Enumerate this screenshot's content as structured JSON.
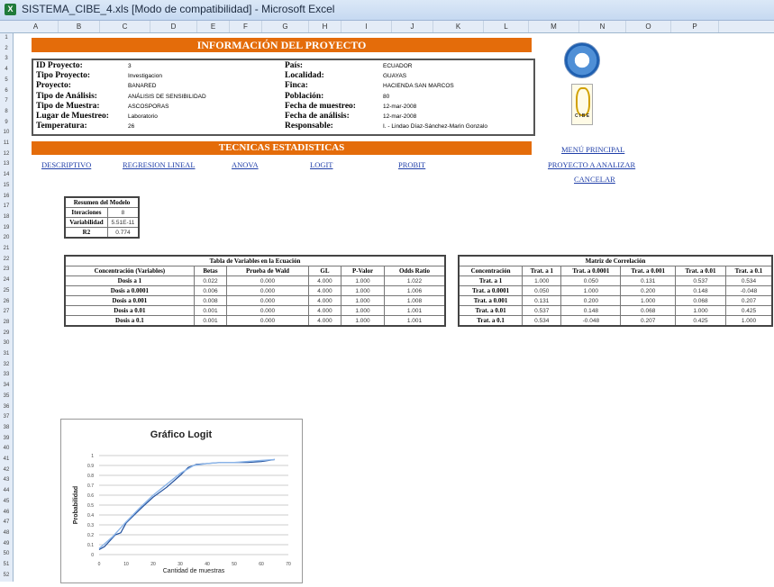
{
  "window": {
    "title": "SISTEMA_CIBE_4.xls  [Modo de compatibilidad] - Microsoft Excel",
    "app_icon": "excel-icon"
  },
  "columns": [
    "A",
    "B",
    "C",
    "D",
    "E",
    "F",
    "G",
    "H",
    "I",
    "J",
    "K",
    "L",
    "M",
    "N",
    "O",
    "P"
  ],
  "rows": [
    "1",
    "2",
    "3",
    "4",
    "5",
    "6",
    "7",
    "8",
    "9",
    "10",
    "11",
    "12",
    "13",
    "14",
    "15",
    "16",
    "17",
    "18",
    "19",
    "20",
    "21",
    "22",
    "23",
    "24",
    "25",
    "26",
    "27",
    "28",
    "29",
    "30",
    "31",
    "32",
    "33",
    "34",
    "35",
    "36",
    "37",
    "38",
    "39",
    "40",
    "41",
    "42",
    "43",
    "44",
    "45",
    "46",
    "47",
    "48",
    "49",
    "50",
    "51",
    "52"
  ],
  "header": {
    "title": "INFORMACIÓN DEL PROYECTO"
  },
  "info": {
    "left": [
      {
        "label": "ID Proyecto:",
        "value": "3"
      },
      {
        "label": "Tipo Proyecto:",
        "value": "Investigacion"
      },
      {
        "label": "Proyecto:",
        "value": "BANARED"
      },
      {
        "label": "Tipo de Análisis:",
        "value": "ANÁLISIS DE SENSIBILIDAD"
      },
      {
        "label": "Tipo de Muestra:",
        "value": "ASCOSPORAS"
      },
      {
        "label": "Lugar de Muestreo:",
        "value": "Laboratorio"
      },
      {
        "label": "Temperatura:",
        "value": "26"
      }
    ],
    "right": [
      {
        "label": "País:",
        "value": "ECUADOR"
      },
      {
        "label": "Localidad:",
        "value": "GUAYAS"
      },
      {
        "label": "Finca:",
        "value": "HACIENDA SAN MARCOS"
      },
      {
        "label": "Población:",
        "value": "80"
      },
      {
        "label": "Fecha de muestreo:",
        "value": "12-mar-2008"
      },
      {
        "label": "Fecha de análisis:",
        "value": "12-mar-2008"
      },
      {
        "label": "Responsable:",
        "value": "I. - Lindao Díaz-Sánchez-Marin Gonzalo"
      }
    ]
  },
  "logos": {
    "logo1": "university-seal",
    "logo2_text": "C I B E"
  },
  "techniques": {
    "title": "TECNICAS ESTADISTICAS",
    "links": [
      "DESCRIPTIVO",
      "REGRESION LINEAL",
      "ANOVA",
      "LOGIT",
      "PROBIT"
    ]
  },
  "menu": {
    "principal": "MENÚ PRINCIPAL",
    "proyecto": "PROYECTO A ANALIZAR",
    "cancelar": "CANCELAR"
  },
  "model_summary": {
    "title": "Resumen del Modelo",
    "rows": [
      {
        "label": "Iteraciones",
        "value": "8"
      },
      {
        "label": "Variabilidad",
        "value": "5.51E-11"
      },
      {
        "label": "R2",
        "value": "0.774"
      }
    ]
  },
  "variables_table": {
    "title": "Tabla de Variables en la Ecuación",
    "headers": [
      "Concentración (Variables)",
      "Betas",
      "Prueba de Wald",
      "GL",
      "P-Valor",
      "Odds Ratio"
    ],
    "rows": [
      [
        "Dosis a 1",
        "0.022",
        "0.000",
        "4.000",
        "1.000",
        "1.022"
      ],
      [
        "Dosis a 0.0001",
        "0.006",
        "0.000",
        "4.000",
        "1.000",
        "1.006"
      ],
      [
        "Dosis a 0.001",
        "0.008",
        "0.000",
        "4.000",
        "1.000",
        "1.008"
      ],
      [
        "Dosis a 0.01",
        "0.001",
        "0.000",
        "4.000",
        "1.000",
        "1.001"
      ],
      [
        "Dosis a 0.1",
        "0.001",
        "0.000",
        "4.000",
        "1.000",
        "1.001"
      ]
    ]
  },
  "correlation_table": {
    "title": "Matriz de Correlación",
    "headers": [
      "Concentración",
      "Trat. a 1",
      "Trat. a 0.0001",
      "Trat. a 0.001",
      "Trat. a 0.01",
      "Trat. a 0.1"
    ],
    "rows": [
      [
        "Trat. a 1",
        "1.000",
        "0.050",
        "0.131",
        "0.537",
        "0.534"
      ],
      [
        "Trat. a 0.0001",
        "0.050",
        "1.000",
        "0.200",
        "0.148",
        "-0.048"
      ],
      [
        "Trat. a 0.001",
        "0.131",
        "0.200",
        "1.000",
        "0.068",
        "0.207"
      ],
      [
        "Trat. a 0.01",
        "0.537",
        "0.148",
        "0.068",
        "1.000",
        "0.425"
      ],
      [
        "Trat. a 0.1",
        "0.534",
        "-0.048",
        "0.207",
        "0.425",
        "1.000"
      ]
    ]
  },
  "chart_data": {
    "type": "line",
    "title": "Gráfico Logit",
    "xlabel": "Cantidad de muestras",
    "ylabel": "Probabilidad",
    "xlim": [
      0,
      70
    ],
    "ylim": [
      0,
      1
    ],
    "xticks": [
      "0",
      "10",
      "20",
      "30",
      "40",
      "50",
      "60",
      "70"
    ],
    "yticks": [
      "0",
      "0.1",
      "0.2",
      "0.3",
      "0.4",
      "0.5",
      "0.6",
      "0.7",
      "0.8",
      "0.9",
      "1"
    ],
    "grid": true,
    "series": [
      {
        "color": "#1f4e9c",
        "x": [
          0,
          2,
          4,
          6,
          8,
          10,
          13,
          16,
          20,
          25,
          30,
          33,
          36,
          40,
          45,
          50,
          55,
          60,
          65
        ],
        "y": [
          0.05,
          0.08,
          0.14,
          0.2,
          0.22,
          0.32,
          0.4,
          0.48,
          0.58,
          0.68,
          0.8,
          0.88,
          0.91,
          0.92,
          0.93,
          0.93,
          0.93,
          0.94,
          0.96
        ]
      },
      {
        "color": "#8ab4e8",
        "x": [
          0,
          5,
          10,
          15,
          20,
          25,
          30,
          35,
          40,
          45,
          50,
          55,
          60,
          65
        ],
        "y": [
          0.06,
          0.18,
          0.33,
          0.47,
          0.6,
          0.71,
          0.82,
          0.9,
          0.92,
          0.93,
          0.93,
          0.94,
          0.95,
          0.96
        ]
      }
    ]
  }
}
